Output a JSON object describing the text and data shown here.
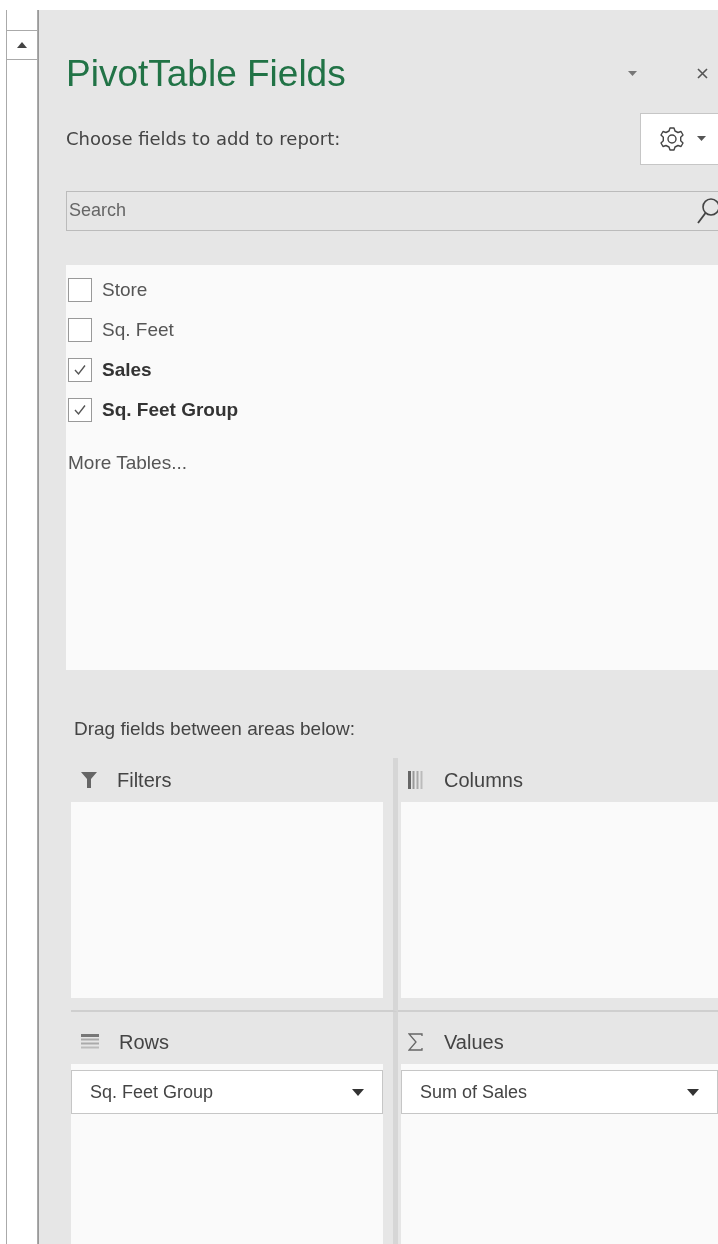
{
  "panel": {
    "title": "PivotTable Fields",
    "subtitle": "Choose fields to add to report:"
  },
  "search": {
    "placeholder": "Search"
  },
  "fields": [
    {
      "label": "Store",
      "checked": false
    },
    {
      "label": "Sq. Feet",
      "checked": false
    },
    {
      "label": "Sales",
      "checked": true
    },
    {
      "label": "Sq. Feet Group",
      "checked": true
    }
  ],
  "more_tables": "More Tables...",
  "areas_hint": "Drag fields between areas below:",
  "areas": [
    {
      "kind": "filters",
      "label": "Filters"
    },
    {
      "kind": "columns",
      "label": "Columns"
    },
    {
      "kind": "rows",
      "label": "Rows",
      "items": [
        "Sq. Feet Group"
      ]
    },
    {
      "kind": "values",
      "label": "Values",
      "items": [
        "Sum of Sales"
      ]
    }
  ]
}
